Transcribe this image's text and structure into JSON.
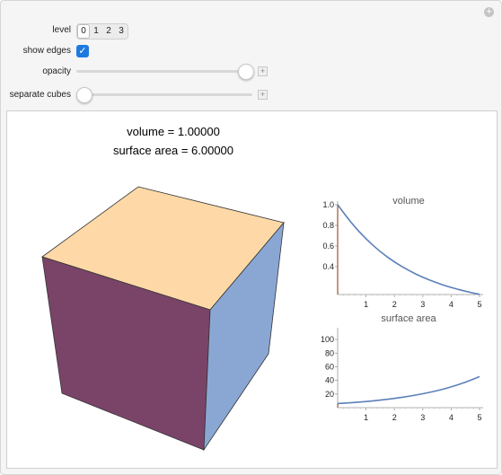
{
  "controls": {
    "level": {
      "label": "level",
      "options": [
        "0",
        "1",
        "2",
        "3"
      ],
      "selected": "0"
    },
    "show_edges": {
      "label": "show edges",
      "checked": true
    },
    "opacity": {
      "label": "opacity",
      "value": 1.0
    },
    "separate_cubes": {
      "label": "separate cubes",
      "value": 0.0
    }
  },
  "readout": {
    "volume": "volume = 1.00000",
    "surface_area": "surface area = 6.00000"
  },
  "cube_colors": {
    "top": "#fed9a7",
    "left": "#7a4468",
    "right": "#8aa7d4",
    "edge": "#333333"
  },
  "chart_data": [
    {
      "type": "line",
      "title": "volume",
      "x": [
        0,
        0.5,
        1,
        1.5,
        2,
        2.5,
        3,
        3.5,
        4,
        4.5,
        5
      ],
      "y": [
        1.0,
        0.816,
        0.667,
        0.544,
        0.444,
        0.363,
        0.296,
        0.242,
        0.198,
        0.161,
        0.132
      ],
      "xticks": [
        "1",
        "2",
        "3",
        "4",
        "5"
      ],
      "yticks": [
        "0.4",
        "0.6",
        "0.8",
        "1.0"
      ],
      "xlim": [
        0,
        5
      ],
      "ylim": [
        0.13,
        1.0
      ],
      "color": "#5b80b8",
      "marker_color": "#a0522d"
    },
    {
      "type": "line",
      "title": "surface area",
      "x": [
        0,
        0.5,
        1,
        1.5,
        2,
        2.5,
        3,
        3.5,
        4,
        4.5,
        5
      ],
      "y": [
        6.0,
        7.35,
        9.0,
        11.02,
        13.5,
        16.54,
        20.25,
        24.8,
        30.38,
        37.2,
        45.56
      ],
      "xticks": [
        "1",
        "2",
        "3",
        "4",
        "5"
      ],
      "yticks": [
        "20",
        "40",
        "60",
        "80",
        "100"
      ],
      "xlim": [
        0,
        5
      ],
      "ylim": [
        0,
        112
      ],
      "color": "#5b80b8",
      "marker_color": "#a0522d"
    }
  ]
}
